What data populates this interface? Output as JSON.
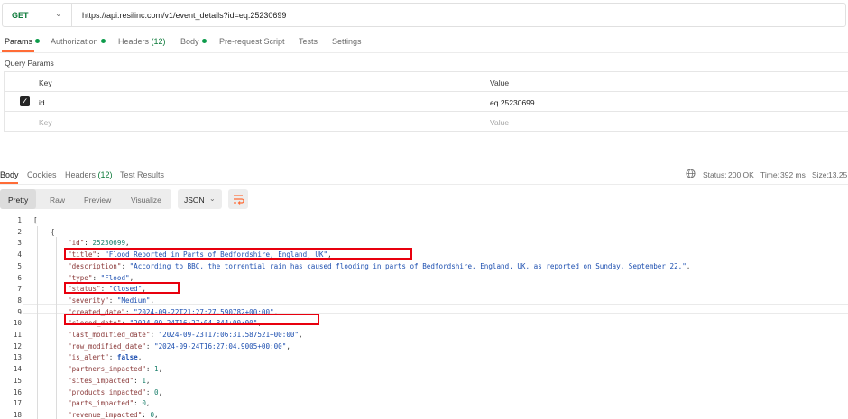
{
  "request": {
    "method": "GET",
    "url": "https://api.resilinc.com/v1/event_details?id=eq.25230699"
  },
  "request_tabs": [
    {
      "label": "Params",
      "dot": true
    },
    {
      "label": "Authorization",
      "dot": true
    },
    {
      "label": "Headers",
      "count": "(12)"
    },
    {
      "label": "Body",
      "dot": true
    },
    {
      "label": "Pre-request Script"
    },
    {
      "label": "Tests"
    },
    {
      "label": "Settings"
    }
  ],
  "query_params": {
    "title": "Query Params",
    "headers": {
      "key": "Key",
      "value": "Value"
    },
    "rows": [
      {
        "key": "id",
        "value": "eq.25230699",
        "checked": true
      }
    ],
    "placeholder": {
      "key": "Key",
      "value": "Value"
    }
  },
  "response_tabs": [
    {
      "label": "Body"
    },
    {
      "label": "Cookies"
    },
    {
      "label": "Headers",
      "count": "(12)"
    },
    {
      "label": "Test Results"
    }
  ],
  "response_status": {
    "status_label": "Status:",
    "status_value": "200 OK",
    "time_label": "Time:",
    "time_value": "392 ms",
    "size_label": "Size:",
    "size_value": "13.25"
  },
  "view_modes": [
    "Pretty",
    "Raw",
    "Preview",
    "Visualize"
  ],
  "format": "JSON",
  "code_lines": [
    {
      "n": "1",
      "indent": 0,
      "parts": [
        [
          "p",
          "["
        ]
      ]
    },
    {
      "n": "2",
      "indent": 1,
      "parts": [
        [
          "p",
          "{"
        ]
      ]
    },
    {
      "n": "3",
      "indent": 2,
      "parts": [
        [
          "k",
          "\"id\""
        ],
        [
          "p",
          ": "
        ],
        [
          "n",
          "25230699"
        ],
        [
          "p",
          ","
        ]
      ]
    },
    {
      "n": "4",
      "indent": 2,
      "parts": [
        [
          "k",
          "\"title\""
        ],
        [
          "p",
          ": "
        ],
        [
          "s",
          "\"Flood Reported in Parts of Bedfordshire, England, UK\""
        ],
        [
          "p",
          ","
        ]
      ]
    },
    {
      "n": "5",
      "indent": 2,
      "parts": [
        [
          "k",
          "\"description\""
        ],
        [
          "p",
          ": "
        ],
        [
          "s",
          "\"According to BBC, the torrential rain has caused flooding in parts of Bedfordshire, England, UK, as reported on Sunday, September 22.\""
        ],
        [
          "p",
          ","
        ]
      ]
    },
    {
      "n": "6",
      "indent": 2,
      "parts": [
        [
          "k",
          "\"type\""
        ],
        [
          "p",
          ": "
        ],
        [
          "s",
          "\"Flood\""
        ],
        [
          "p",
          ","
        ]
      ]
    },
    {
      "n": "7",
      "indent": 2,
      "parts": [
        [
          "k",
          "\"status\""
        ],
        [
          "p",
          ": "
        ],
        [
          "s",
          "\"Closed\""
        ],
        [
          "p",
          ","
        ]
      ]
    },
    {
      "n": "8",
      "indent": 2,
      "parts": [
        [
          "k",
          "\"severity\""
        ],
        [
          "p",
          ": "
        ],
        [
          "s",
          "\"Medium\""
        ],
        [
          "p",
          ","
        ]
      ]
    },
    {
      "n": "9",
      "indent": 2,
      "parts": [
        [
          "k",
          "\"created_date\""
        ],
        [
          "p",
          ": "
        ],
        [
          "s",
          "\"2024-09-22T21:27:27.590782+00:00\""
        ],
        [
          "p",
          ","
        ]
      ]
    },
    {
      "n": "10",
      "indent": 2,
      "parts": [
        [
          "k",
          "\"closed_date\""
        ],
        [
          "p",
          ": "
        ],
        [
          "s",
          "\"2024-09-24T16:27:04.844+00:00\""
        ],
        [
          "p",
          ","
        ]
      ]
    },
    {
      "n": "11",
      "indent": 2,
      "parts": [
        [
          "k",
          "\"last_modified_date\""
        ],
        [
          "p",
          ": "
        ],
        [
          "s",
          "\"2024-09-23T17:06:31.587521+00:00\""
        ],
        [
          "p",
          ","
        ]
      ]
    },
    {
      "n": "12",
      "indent": 2,
      "parts": [
        [
          "k",
          "\"row_modified_date\""
        ],
        [
          "p",
          ": "
        ],
        [
          "s",
          "\"2024-09-24T16:27:04.9005+00:00\""
        ],
        [
          "p",
          ","
        ]
      ]
    },
    {
      "n": "13",
      "indent": 2,
      "parts": [
        [
          "k",
          "\"is_alert\""
        ],
        [
          "p",
          ": "
        ],
        [
          "b",
          "false"
        ],
        [
          "p",
          ","
        ]
      ]
    },
    {
      "n": "14",
      "indent": 2,
      "parts": [
        [
          "k",
          "\"partners_impacted\""
        ],
        [
          "p",
          ": "
        ],
        [
          "n",
          "1"
        ],
        [
          "p",
          ","
        ]
      ]
    },
    {
      "n": "15",
      "indent": 2,
      "parts": [
        [
          "k",
          "\"sites_impacted\""
        ],
        [
          "p",
          ": "
        ],
        [
          "n",
          "1"
        ],
        [
          "p",
          ","
        ]
      ]
    },
    {
      "n": "16",
      "indent": 2,
      "parts": [
        [
          "k",
          "\"products_impacted\""
        ],
        [
          "p",
          ": "
        ],
        [
          "n",
          "0"
        ],
        [
          "p",
          ","
        ]
      ]
    },
    {
      "n": "17",
      "indent": 2,
      "parts": [
        [
          "k",
          "\"parts_impacted\""
        ],
        [
          "p",
          ": "
        ],
        [
          "n",
          "0"
        ],
        [
          "p",
          ","
        ]
      ]
    },
    {
      "n": "18",
      "indent": 2,
      "parts": [
        [
          "k",
          "\"revenue_impacted\""
        ],
        [
          "p",
          ": "
        ],
        [
          "n",
          "0"
        ],
        [
          "p",
          ","
        ]
      ]
    }
  ],
  "colors": {
    "accent": "#ff6c37",
    "success": "#0d7a3a",
    "highlight": "#e8000e"
  }
}
